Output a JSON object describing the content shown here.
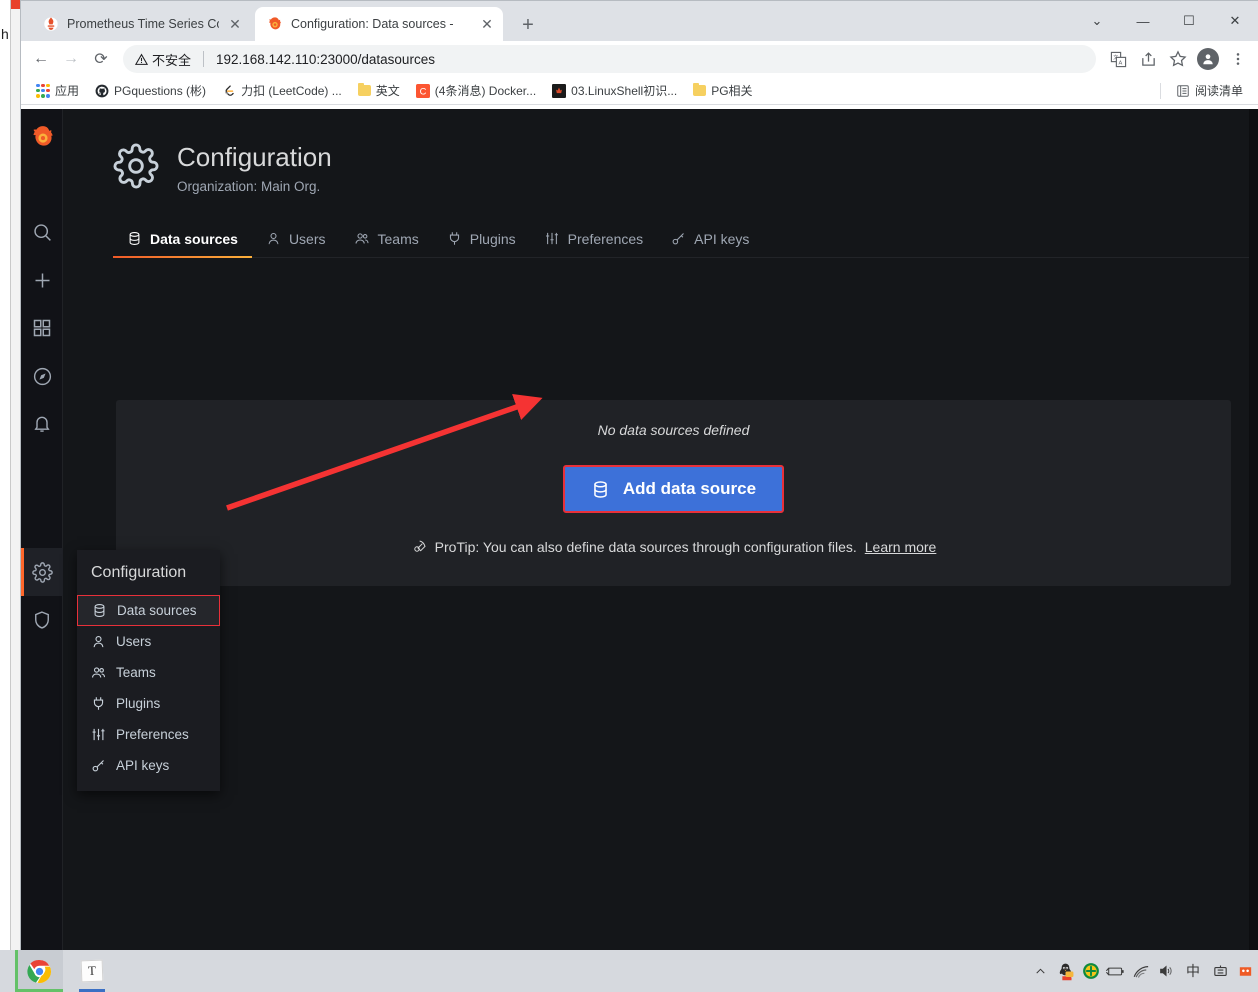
{
  "browser": {
    "tabs": [
      {
        "title": "Prometheus Time Series Collec",
        "favicon": "prometheus-icon",
        "active": false
      },
      {
        "title": "Configuration: Data sources - ",
        "favicon": "grafana-icon",
        "active": true
      }
    ],
    "new_tab_label": "+",
    "window_controls": {
      "minimize_group": "⌄",
      "minimize": "—",
      "maximize": "☐",
      "close": "✕"
    },
    "toolbar": {
      "back": "←",
      "forward": "→",
      "reload": "⟳",
      "security_label": "不安全",
      "url": "192.168.142.110:23000/datasources",
      "translate_icon": "translate-icon",
      "share_icon": "share-icon",
      "bookmark_icon": "star-icon",
      "profile_icon": "profile-icon",
      "menu_icon": "kebab-menu-icon"
    },
    "bookmarks": [
      {
        "label": "应用",
        "icon": "apps-grid-icon"
      },
      {
        "label": "PGquestions (彬)",
        "icon": "github-icon"
      },
      {
        "label": "力扣 (LeetCode) ...",
        "icon": "leetcode-icon"
      },
      {
        "label": "英文",
        "icon": "folder-icon"
      },
      {
        "label": "(4条消息) Docker...",
        "icon": "csdn-icon"
      },
      {
        "label": "03.LinuxShell初识...",
        "icon": "dark-site-icon"
      },
      {
        "label": "PG相关",
        "icon": "folder-icon"
      }
    ],
    "reading_list": {
      "label": "阅读清单",
      "icon": "reading-list-icon"
    }
  },
  "grafana": {
    "navrail": [
      {
        "name": "search",
        "icon": "search-icon"
      },
      {
        "name": "create",
        "icon": "plus-icon"
      },
      {
        "name": "dashboards",
        "icon": "dashboards-icon"
      },
      {
        "name": "explore",
        "icon": "compass-icon"
      },
      {
        "name": "alerting",
        "icon": "bell-icon"
      },
      {
        "name": "configuration",
        "icon": "gear-icon",
        "active": true
      },
      {
        "name": "server-admin",
        "icon": "shield-icon"
      }
    ],
    "header": {
      "icon": "gear-icon",
      "title": "Configuration",
      "subtitle": "Organization: Main Org."
    },
    "tabs": [
      {
        "label": "Data sources",
        "icon": "database-icon",
        "selected": true
      },
      {
        "label": "Users",
        "icon": "user-icon",
        "selected": false
      },
      {
        "label": "Teams",
        "icon": "users-icon",
        "selected": false
      },
      {
        "label": "Plugins",
        "icon": "plug-icon",
        "selected": false
      },
      {
        "label": "Preferences",
        "icon": "sliders-icon",
        "selected": false
      },
      {
        "label": "API keys",
        "icon": "key-icon",
        "selected": false
      }
    ],
    "content": {
      "empty_message": "No data sources defined",
      "add_button": {
        "label": "Add data source",
        "icon": "database-icon"
      },
      "protip": {
        "icon": "rocket-icon",
        "text": "ProTip: You can also define data sources through configuration files.",
        "link_label": "Learn more"
      }
    },
    "flyout": {
      "title": "Configuration",
      "items": [
        {
          "label": "Data sources",
          "icon": "database-icon",
          "highlighted": true
        },
        {
          "label": "Users",
          "icon": "user-icon",
          "highlighted": false
        },
        {
          "label": "Teams",
          "icon": "users-icon",
          "highlighted": false
        },
        {
          "label": "Plugins",
          "icon": "plug-icon",
          "highlighted": false
        },
        {
          "label": "Preferences",
          "icon": "sliders-icon",
          "highlighted": false
        },
        {
          "label": "API keys",
          "icon": "key-icon",
          "highlighted": false
        }
      ]
    }
  },
  "annotation": {
    "arrow_color": "#f53333",
    "highlight_color": "#e8303a"
  },
  "taskbar": {
    "apps": [
      {
        "name": "chrome",
        "icon": "chrome-icon"
      },
      {
        "name": "sticky-notes",
        "icon": "note-icon",
        "glyph": "T"
      }
    ],
    "tray": [
      {
        "name": "show-hidden-icons",
        "icon": "chevron-up-icon"
      },
      {
        "name": "qq",
        "icon": "penguin-icon"
      },
      {
        "name": "security",
        "icon": "green-shield-icon"
      },
      {
        "name": "battery",
        "icon": "battery-icon"
      },
      {
        "name": "network",
        "icon": "wifi-icon"
      },
      {
        "name": "volume",
        "icon": "speaker-icon"
      },
      {
        "name": "ime",
        "icon": "ime-icon",
        "glyph": "中"
      },
      {
        "name": "ime-panel",
        "icon": "ime-panel-icon"
      }
    ]
  },
  "behind_window": {
    "text": "h"
  },
  "colors": {
    "grafana_bg": "#141619",
    "grafana_panel": "#202226",
    "grafana_navrail": "#111217",
    "accent_orange": "#ff672b",
    "primary_blue": "#3d71d9",
    "annotation_red": "#e8303a",
    "chrome_tabstrip": "#dee1e6",
    "taskbar": "#d6d9de"
  }
}
